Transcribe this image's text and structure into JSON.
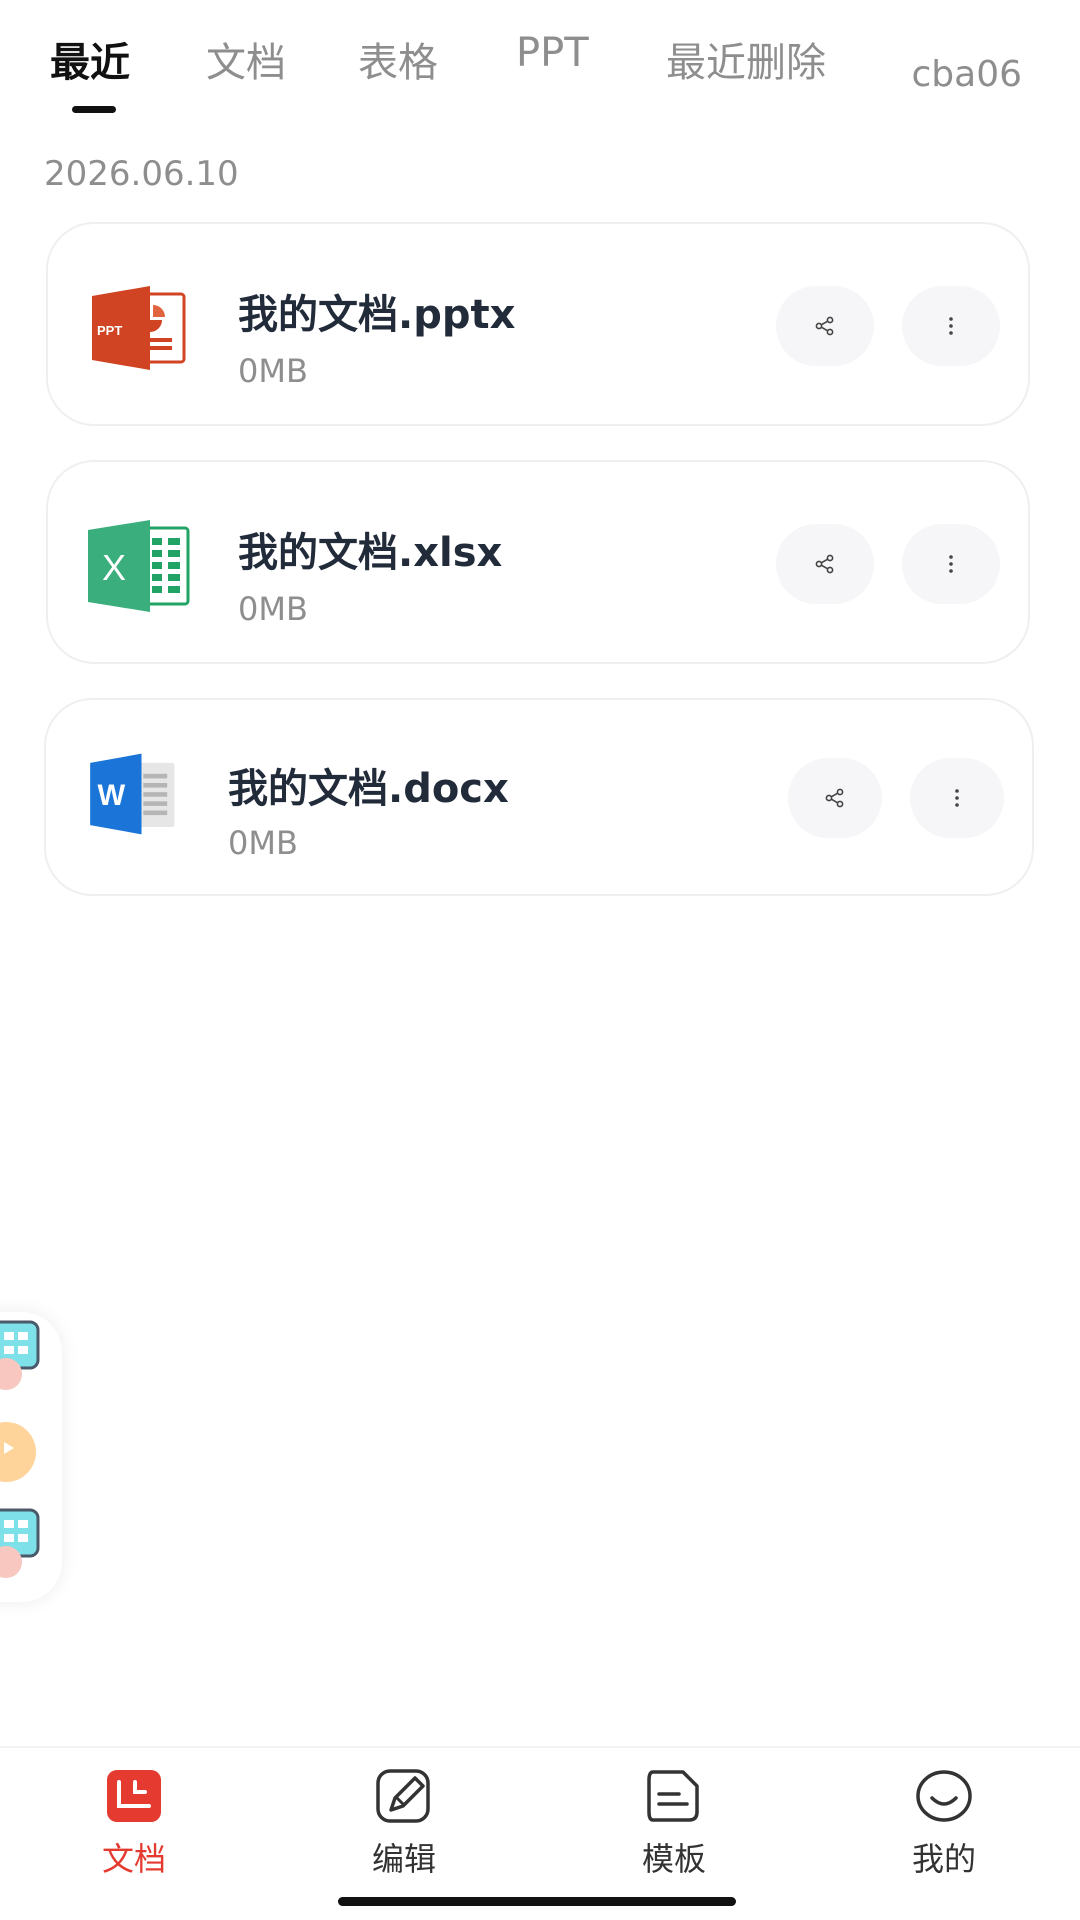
{
  "tabs": [
    {
      "label": "最近",
      "active": true
    },
    {
      "label": "文档",
      "active": false
    },
    {
      "label": "表格",
      "active": false
    },
    {
      "label": "PPT",
      "active": false
    },
    {
      "label": "最近删除",
      "active": false
    }
  ],
  "account": "cba06",
  "date_label": "2026.06.10",
  "files": [
    {
      "name": "我的文档.pptx",
      "size": "0MB",
      "icon": "ppt-file-icon"
    },
    {
      "name": "我的文档.xlsx",
      "size": "0MB",
      "icon": "excel-file-icon"
    },
    {
      "name": "我的文档.docx",
      "size": "0MB",
      "icon": "word-file-icon"
    }
  ],
  "colors": {
    "accent": "#e53a2f",
    "ppt": "#d04423",
    "excel": "#21a366",
    "word": "#185abd",
    "text_primary": "#222b3a",
    "text_secondary": "#8e8e8e"
  },
  "bottom_nav": [
    {
      "label": "文档",
      "icon": "document-icon",
      "active": true
    },
    {
      "label": "编辑",
      "icon": "edit-pen-icon",
      "active": false
    },
    {
      "label": "模板",
      "icon": "template-icon",
      "active": false
    },
    {
      "label": "我的",
      "icon": "smiley-face-icon",
      "active": false
    }
  ]
}
